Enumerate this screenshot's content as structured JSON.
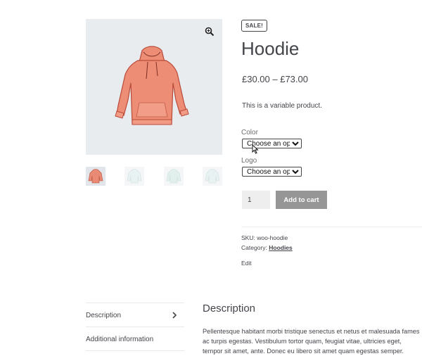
{
  "product": {
    "badge": "SALE!",
    "title": "Hoodie",
    "price": "£30.00 – £73.00",
    "short_description": "This is a variable product.",
    "image_alt": "hoodie-illustration"
  },
  "gallery": {
    "thumbnails": [
      {
        "name": "thumb-red-hoodie",
        "active": true
      },
      {
        "name": "thumb-hoodie-2",
        "active": false
      },
      {
        "name": "thumb-hoodie-3",
        "active": false
      },
      {
        "name": "thumb-hoodie-4",
        "active": false
      }
    ]
  },
  "variations": {
    "color_label": "Color",
    "color_value": "Choose an option",
    "logo_label": "Logo",
    "logo_value": "Choose an option"
  },
  "cart": {
    "quantity": "1",
    "add_label": "Add to cart"
  },
  "meta": {
    "sku_label": "SKU:",
    "sku_value": "woo-hoodie",
    "category_label": "Category:",
    "category_value": "Hoodies",
    "edit_label": "Edit"
  },
  "tabs": {
    "items": [
      "Description",
      "Additional information"
    ],
    "active": "Description"
  },
  "description": {
    "heading": "Description",
    "body": "Pellentesque habitant morbi tristique senectus et netus et malesuada fames ac turpis egestas. Vestibulum tortor quam, feugiat vitae, ultricies eget, tempor sit amet, ante. Donec eu libero sit amet quam egestas semper."
  },
  "colors": {
    "hoodie": "#ee8d76",
    "button": "#969696",
    "image_bg": "#e9ecef"
  }
}
